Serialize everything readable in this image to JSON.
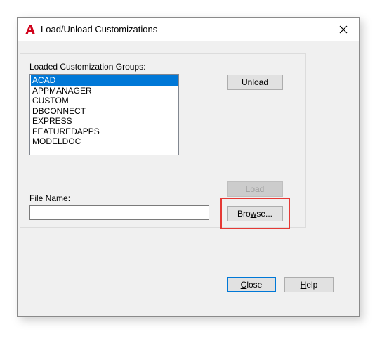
{
  "window": {
    "title": "Load/Unload Customizations",
    "app_icon": "autocad-a-logo",
    "close_glyph": "✕"
  },
  "groups_section": {
    "label": "Loaded Customization Groups:",
    "items": [
      "ACAD",
      "APPMANAGER",
      "CUSTOM",
      "DBCONNECT",
      "EXPRESS",
      "FEATUREDAPPS",
      "MODELDOC"
    ],
    "selected_index": 0,
    "unload_button": {
      "mnemonic": "U",
      "rest": "nload"
    }
  },
  "file_section": {
    "label": {
      "mnemonic": "F",
      "rest": "ile Name:"
    },
    "value": "",
    "load_button": {
      "mnemonic": "L",
      "rest": "oad",
      "enabled": false
    },
    "browse_button": {
      "mnemonic": "w",
      "before": "Bro",
      "after": "se..."
    }
  },
  "footer": {
    "close_button": {
      "mnemonic": "C",
      "rest": "lose"
    },
    "help_button": {
      "mnemonic": "H",
      "rest": "elp"
    }
  },
  "colors": {
    "selection": "#0078d7",
    "highlight_annotation": "#e53935",
    "app_icon": "#d0021b"
  }
}
